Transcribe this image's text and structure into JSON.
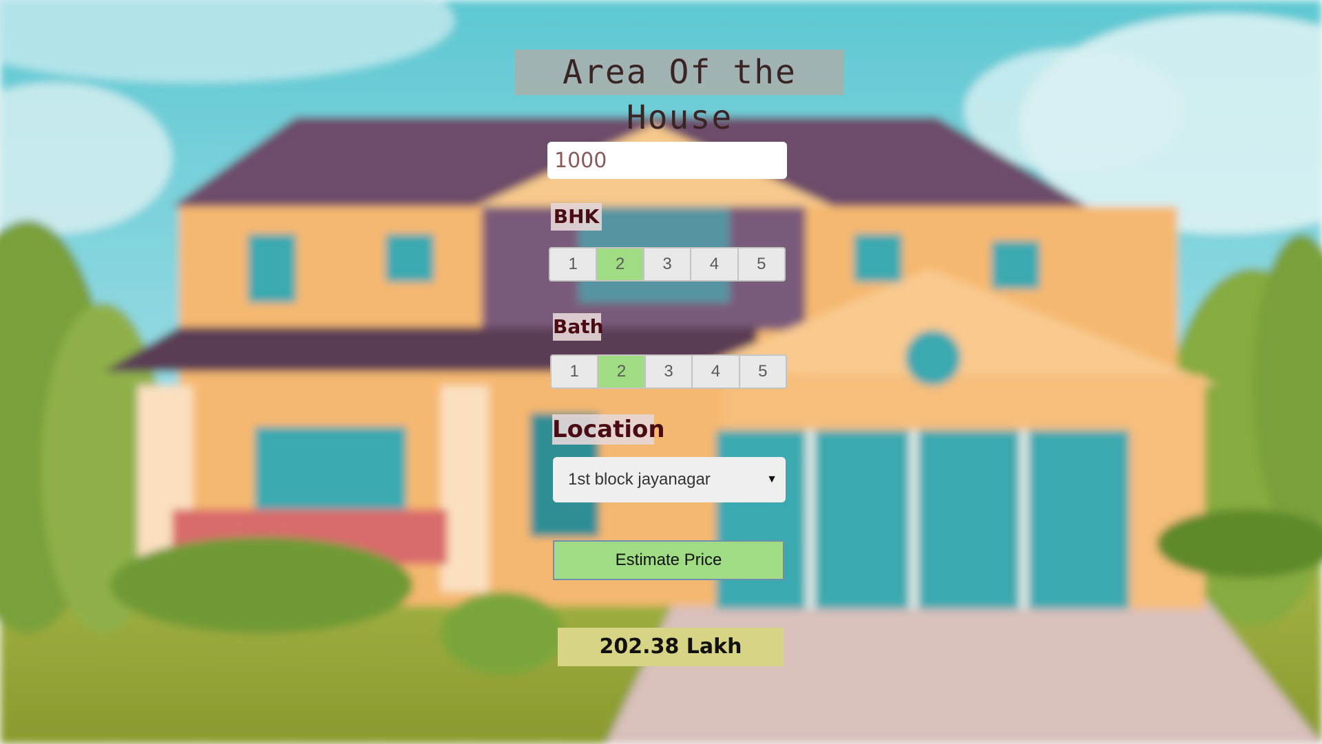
{
  "form": {
    "title": "Area Of the House",
    "area_value": "1000",
    "bhk_label": "BHK",
    "bhk_options": [
      "1",
      "2",
      "3",
      "4",
      "5"
    ],
    "bhk_selected": "2",
    "bath_label": "Bath",
    "bath_options": [
      "1",
      "2",
      "3",
      "4",
      "5"
    ],
    "bath_selected": "2",
    "location_label": "Location",
    "location_value": "1st block jayanagar",
    "estimate_button": "Estimate Price",
    "result": "202.38 Lakh"
  },
  "colors": {
    "accent_green": "#9fdc84",
    "result_bg": "#d7d585",
    "label_text": "#4a0c14"
  }
}
